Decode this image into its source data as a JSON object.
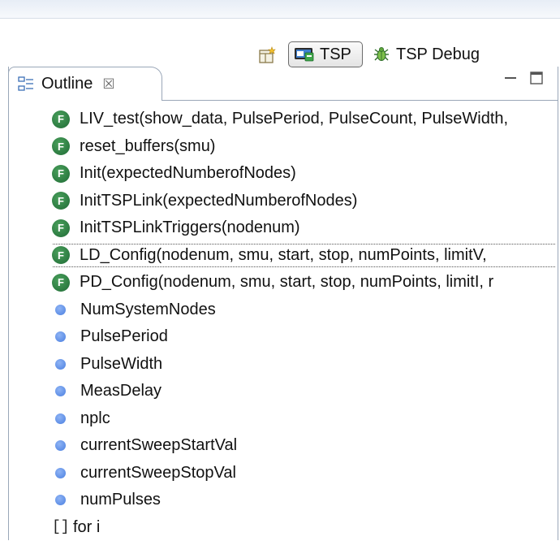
{
  "perspectives": {
    "open_icon": "open-perspective-icon",
    "items": [
      {
        "label": "TSP",
        "icon": "tsp-perspective-icon",
        "active": true
      },
      {
        "label": "TSP Debug",
        "icon": "debug-bug-icon",
        "active": false
      }
    ]
  },
  "outline": {
    "tab_label": "Outline",
    "tab_icon": "outline-icon",
    "close_glyph": "☒",
    "items": [
      {
        "kind": "function",
        "label": "LIV_test(show_data, PulsePeriod, PulseCount, PulseWidth,"
      },
      {
        "kind": "function",
        "label": "reset_buffers(smu)"
      },
      {
        "kind": "function",
        "label": "Init(expectedNumberofNodes)"
      },
      {
        "kind": "function",
        "label": "InitTSPLink(expectedNumberofNodes)"
      },
      {
        "kind": "function",
        "label": "InitTSPLinkTriggers(nodenum)"
      },
      {
        "kind": "function",
        "label": "LD_Config(nodenum, smu, start, stop, numPoints, limitV,",
        "selected": true
      },
      {
        "kind": "function",
        "label": "PD_Config(nodenum, smu, start, stop, numPoints, limitI, r"
      },
      {
        "kind": "variable",
        "label": "NumSystemNodes"
      },
      {
        "kind": "variable",
        "label": "PulsePeriod"
      },
      {
        "kind": "variable",
        "label": "PulseWidth"
      },
      {
        "kind": "variable",
        "label": "MeasDelay"
      },
      {
        "kind": "variable",
        "label": "nplc"
      },
      {
        "kind": "variable",
        "label": "currentSweepStartVal"
      },
      {
        "kind": "variable",
        "label": "currentSweepStopVal"
      },
      {
        "kind": "variable",
        "label": "numPulses"
      },
      {
        "kind": "loop",
        "label": "for i"
      }
    ],
    "function_badge": "F",
    "loop_glyph": "[]"
  },
  "colors": {
    "function_icon": "#2e7d3e",
    "variable_icon": "#6b9af0",
    "border": "#9aa7b8"
  }
}
